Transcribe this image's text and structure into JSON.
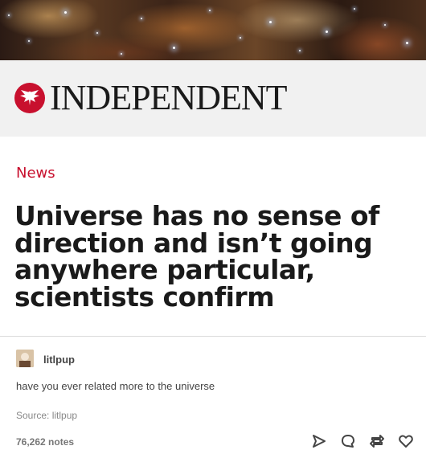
{
  "masthead": {
    "logo_text": "INDEPENDENT",
    "brand_color": "#c8102e"
  },
  "article": {
    "section": "News",
    "headline": "Universe has no sense of direction and isn’t going anywhere particular, scientists confirm"
  },
  "post": {
    "username": "litlpup",
    "caption": "have you ever related more to the universe",
    "source_label": "Source:",
    "source_name": "litlpup",
    "notes": "76,262 notes"
  },
  "actions": [
    {
      "name": "share-icon"
    },
    {
      "name": "reply-icon"
    },
    {
      "name": "reblog-icon"
    },
    {
      "name": "like-icon"
    }
  ]
}
